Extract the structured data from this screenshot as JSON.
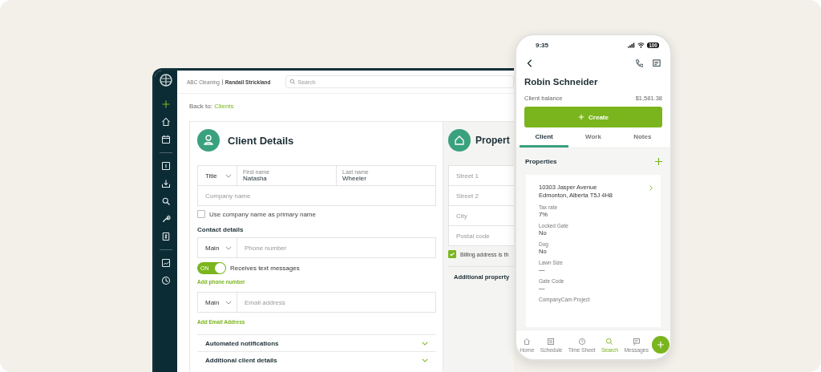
{
  "header": {
    "company": "ABC Cleaning",
    "user": "Randall Strickland",
    "search_placeholder": "Search"
  },
  "breadcrumb": {
    "prefix": "Back to:",
    "link": "Clients"
  },
  "client_details": {
    "title": "Client Details",
    "title_select": "Title",
    "first_name": {
      "label": "First name",
      "value": "Natasha"
    },
    "last_name": {
      "label": "Last name",
      "value": "Wheeler"
    },
    "company_placeholder": "Company name",
    "use_company": {
      "label": "Use company name as primary name",
      "checked": false
    },
    "contact_heading": "Contact details",
    "phone": {
      "type": "Main",
      "placeholder": "Phone number"
    },
    "text_toggle": {
      "label": "Receives text messages",
      "on": true,
      "badge": "ON"
    },
    "add_phone": "Add phone number",
    "email": {
      "type": "Main",
      "placeholder": "Email address"
    },
    "add_email": "Add Email Address",
    "sections": [
      {
        "label": "Automated notifications"
      },
      {
        "label": "Additional client details"
      }
    ]
  },
  "property": {
    "title": "Propert",
    "field_placeholders": [
      "Street 1",
      "Street 2",
      "City",
      "Postal code"
    ],
    "billing": {
      "label": "Billing address is th",
      "checked": true
    },
    "additional": "Additional property"
  },
  "phone": {
    "time": "9:35",
    "battery": "100",
    "name": "Robin Schneider",
    "balance_label": "Client balance",
    "balance": "$1,581.38",
    "create": "Create",
    "tabs": [
      {
        "label": "Client",
        "selected": true
      },
      {
        "label": "Work",
        "selected": false
      },
      {
        "label": "Notes",
        "selected": false
      }
    ],
    "properties_heading": "Properties",
    "address": [
      "10303 Jasper Avenue",
      "Edmonton, Alberta T5J 4H8"
    ],
    "fields": [
      {
        "label": "Tax rate",
        "value": "7%"
      },
      {
        "label": "Locked Gate",
        "value": "No"
      },
      {
        "label": "Dog",
        "value": "No"
      },
      {
        "label": "Lawn Size",
        "value": "—"
      },
      {
        "label": "Gate Code",
        "value": "—"
      },
      {
        "label": "CompanyCam Project"
      }
    ],
    "nav": [
      {
        "label": "Home",
        "kind": "home",
        "selected": false
      },
      {
        "label": "Schedule",
        "kind": "schedule",
        "selected": false
      },
      {
        "label": "Time Sheet",
        "kind": "clock",
        "selected": false
      },
      {
        "label": "Search",
        "kind": "search",
        "selected": true
      },
      {
        "label": "Messages",
        "kind": "message",
        "selected": false
      }
    ]
  }
}
